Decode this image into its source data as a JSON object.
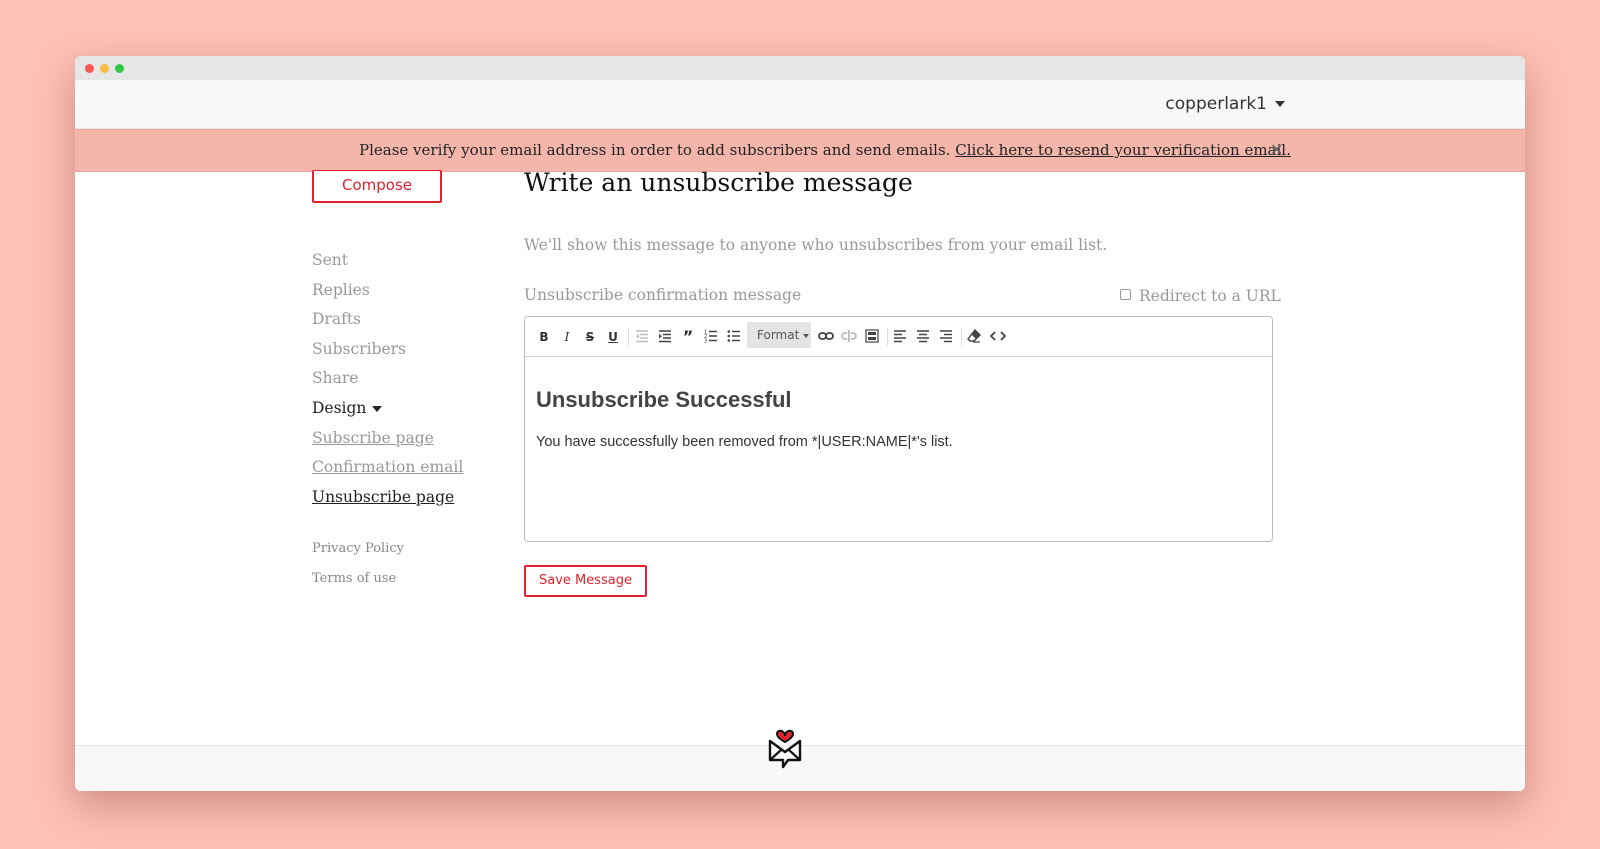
{
  "window": {
    "controls": [
      "close",
      "minimize",
      "maximize"
    ]
  },
  "header": {
    "username": "copperlark1"
  },
  "banner": {
    "message": "Please verify your email address in order to add subscribers and send emails.",
    "link_text": "Click here to resend your verification email.",
    "close_icon": "close-icon"
  },
  "sidebar": {
    "compose_label": "Compose",
    "items": [
      {
        "label": "Sent"
      },
      {
        "label": "Replies"
      },
      {
        "label": "Drafts"
      },
      {
        "label": "Subscribers"
      },
      {
        "label": "Share"
      },
      {
        "label": "Design"
      },
      {
        "label": "Subscribe page"
      },
      {
        "label": "Confirmation email"
      },
      {
        "label": "Unsubscribe page"
      }
    ],
    "footer_links": [
      {
        "label": "Privacy Policy"
      },
      {
        "label": "Terms of use"
      }
    ]
  },
  "main": {
    "title": "Write an unsubscribe message",
    "description": "We'll show this message to anyone who unsubscribes from your email list.",
    "field_label": "Unsubscribe confirmation message",
    "redirect_label": "Redirect to a URL",
    "redirect_checked": false,
    "editor": {
      "toolbar": {
        "bold": "B",
        "italic": "I",
        "strike": "S",
        "underline": "U",
        "format_label": "Format"
      },
      "heading": "Unsubscribe Successful",
      "body": "You have successfully been removed from *|USER:NAME|*'s list."
    },
    "save_label": "Save Message"
  },
  "colors": {
    "accent": "#e0242f",
    "background": "#fdc1b5",
    "banner": "#f4b6ab"
  }
}
